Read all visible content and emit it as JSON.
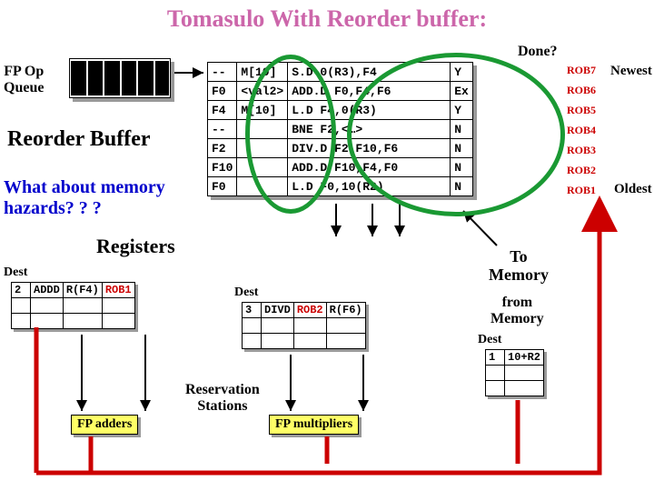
{
  "title": "Tomasulo With Reorder buffer:",
  "labels": {
    "done": "Done?",
    "fpop": "FP Op\nQueue",
    "rob": "Reorder Buffer",
    "memhaz": "What about memory\nhazards? ? ?",
    "registers": "Registers",
    "dest": "Dest",
    "rs": "Reservation\nStations",
    "tomem": "To\nMemory",
    "frommem": "from\nMemory",
    "newest": "Newest",
    "oldest": "Oldest",
    "fpadd": "FP adders",
    "fpmul": "FP multipliers"
  },
  "rob_rows": [
    {
      "dest": "--",
      "val": "M[10]",
      "instr": "S.D 0(R3),F4",
      "done": "Y",
      "tag": "ROB7"
    },
    {
      "dest": "F0",
      "val": "<val2>",
      "instr": "ADD.D F0,F4,F6",
      "done": "Ex",
      "tag": "ROB6"
    },
    {
      "dest": "F4",
      "val": "M[10]",
      "instr": "L.D F4,0(R3)",
      "done": "Y",
      "tag": "ROB5"
    },
    {
      "dest": "--",
      "val": "",
      "instr": "BNE F2,<…>",
      "done": "N",
      "tag": "ROB4"
    },
    {
      "dest": "F2",
      "val": "",
      "instr": "DIV.D F2,F10,F6",
      "done": "N",
      "tag": "ROB3"
    },
    {
      "dest": "F10",
      "val": "",
      "instr": "ADD.D F10,F4,F0",
      "done": "N",
      "tag": "ROB2"
    },
    {
      "dest": "F0",
      "val": "",
      "instr": "L.D F0,10(R2)",
      "done": "N",
      "tag": "ROB1"
    }
  ],
  "rs_add": {
    "tag": "2",
    "op": "ADDD",
    "src1": "R(F4)",
    "src2": "ROB1"
  },
  "rs_mul": {
    "tag": "3",
    "op": "DIVD",
    "src1": "ROB2",
    "src2": "R(F6)"
  },
  "rs_mem": {
    "tag": "1",
    "val": "10+R2"
  }
}
